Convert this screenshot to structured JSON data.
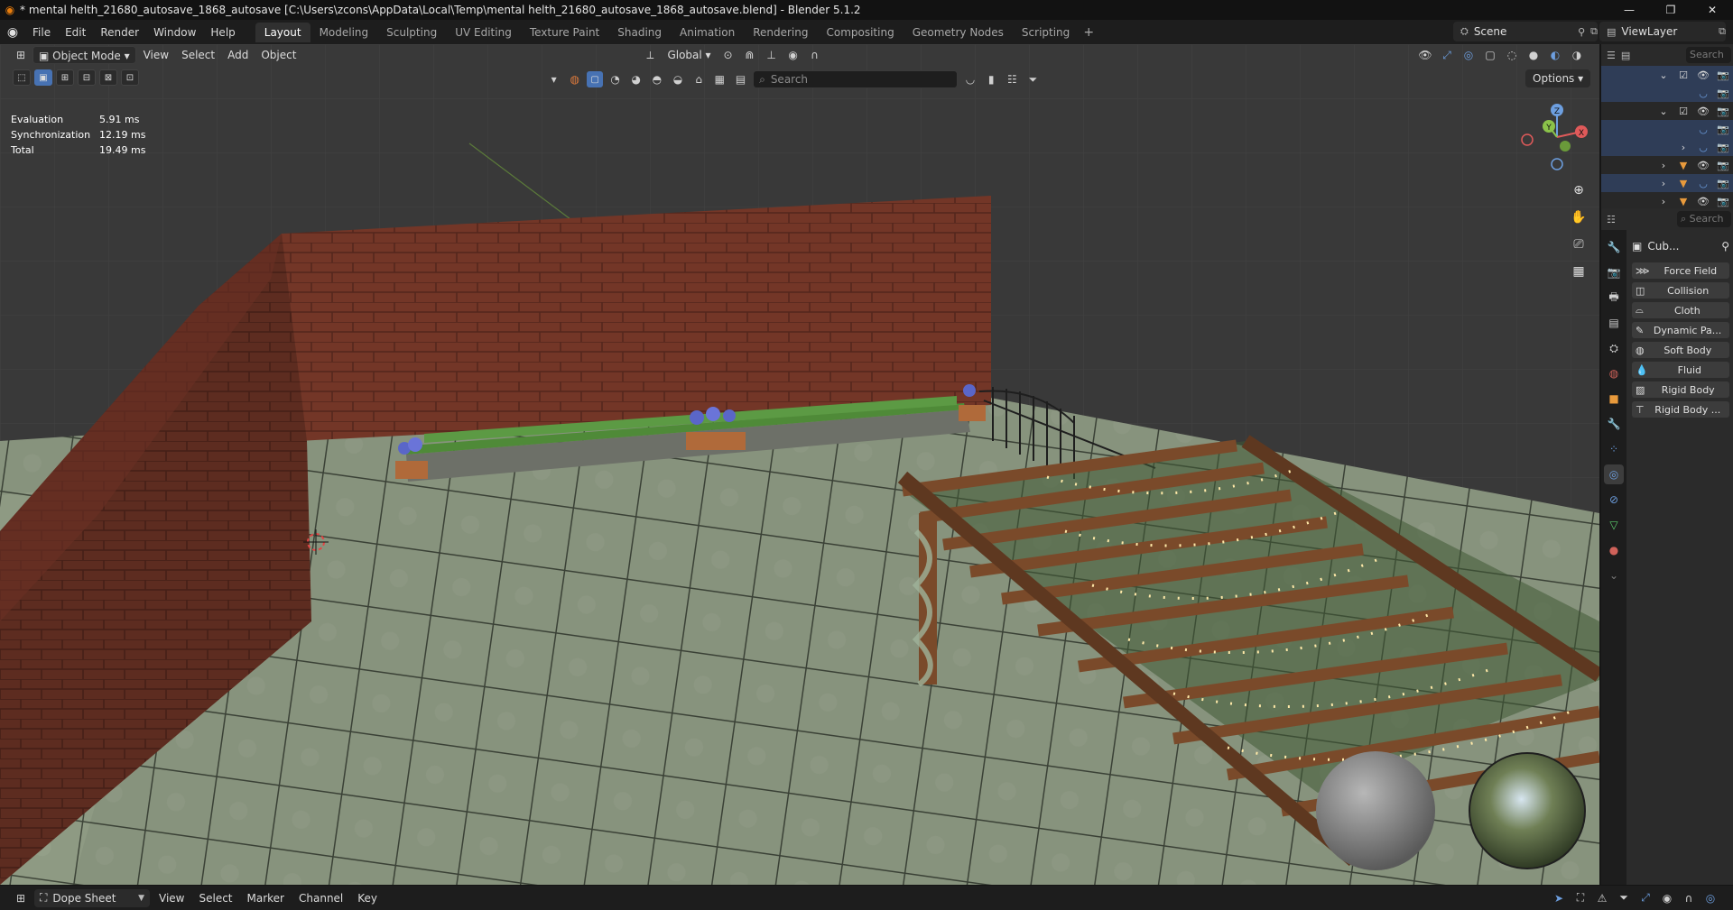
{
  "window": {
    "title": "* mental helth_21680_autosave_1868_autosave [C:\\Users\\zcons\\AppData\\Local\\Temp\\mental helth_21680_autosave_1868_autosave.blend] - Blender 5.1.2",
    "minimize": "—",
    "maximize": "❐",
    "close": "✕"
  },
  "menus": [
    "File",
    "Edit",
    "Render",
    "Window",
    "Help"
  ],
  "workspaces": [
    "Layout",
    "Modeling",
    "Sculpting",
    "UV Editing",
    "Texture Paint",
    "Shading",
    "Animation",
    "Rendering",
    "Compositing",
    "Geometry Nodes",
    "Scripting"
  ],
  "active_workspace": "Layout",
  "workspace_add": "+",
  "scene": {
    "label": "Scene"
  },
  "view_layer": {
    "label": "ViewLayer"
  },
  "viewport_header": {
    "mode": "Object Mode",
    "menus": [
      "View",
      "Select",
      "Add",
      "Object"
    ],
    "orientation": "Global",
    "options": "Options"
  },
  "viewport_search": {
    "placeholder": "Search"
  },
  "stats": [
    {
      "label": "Evaluation",
      "value": "5.91 ms"
    },
    {
      "label": "Synchronization",
      "value": "12.19 ms"
    },
    {
      "label": "Total",
      "value": "19.49 ms"
    }
  ],
  "gizmo": {
    "z": "Z",
    "y": "Y",
    "x": "X"
  },
  "outliner": {
    "search_placeholder": "Search"
  },
  "properties": {
    "search_placeholder": "Search",
    "object_name": "Cub...",
    "physics_buttons": [
      "Force Field",
      "Collision",
      "Cloth",
      "Dynamic Pa...",
      "Soft Body",
      "Fluid",
      "Rigid Body",
      "Rigid Body ..."
    ]
  },
  "dope_sheet": {
    "mode": "Dope Sheet",
    "menus": [
      "View",
      "Select",
      "Marker",
      "Channel",
      "Key"
    ]
  },
  "colors": {
    "accent": "#4772b3",
    "brick": "#7d3b2b",
    "tile": "#8f9b84",
    "wood": "#7a4a2a",
    "lights": "#ffe9a8"
  }
}
